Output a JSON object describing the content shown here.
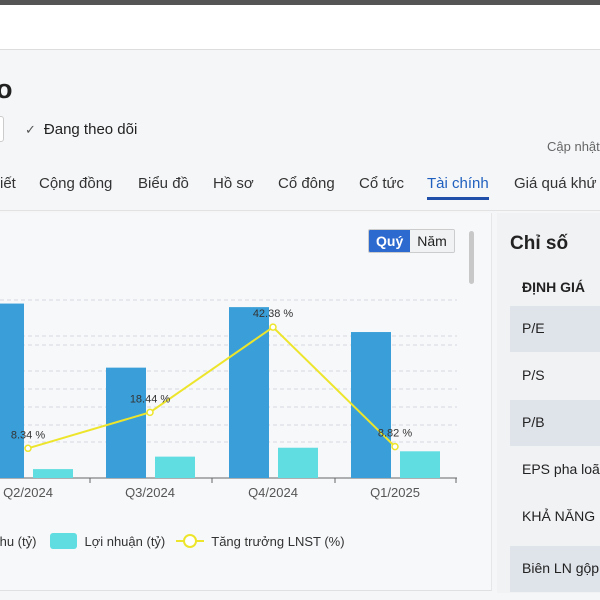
{
  "header": {
    "title": "o",
    "follow_label": "Đang theo dõi",
    "updated_label": "Cập nhật"
  },
  "tabs": [
    {
      "label": "iết"
    },
    {
      "label": "Cộng đồng"
    },
    {
      "label": "Biểu đồ"
    },
    {
      "label": "Hồ sơ"
    },
    {
      "label": "Cổ đông"
    },
    {
      "label": "Cổ tức"
    },
    {
      "label": "Tài chính",
      "active": true
    },
    {
      "label": "Giá quá khứ"
    }
  ],
  "toggle": {
    "quarter": "Quý",
    "year": "Năm"
  },
  "colors": {
    "revenue": "#3a9fd8",
    "profit": "#5fdde0",
    "growth": "#ede52c",
    "accent": "#2d6ad0"
  },
  "chart_data": {
    "type": "bar",
    "categories": [
      "Q2/2024",
      "Q3/2024",
      "Q4/2024",
      "Q1/2025"
    ],
    "series": [
      {
        "name": "Doanh thu (tỷ)",
        "legend_visible": "thu (tỷ)",
        "values": [
          98,
          62,
          96,
          82
        ]
      },
      {
        "name": "Lợi nhuận (tỷ)",
        "values": [
          5,
          12,
          17,
          15
        ]
      },
      {
        "name": "Tăng trưởng LNST (%)",
        "type": "line",
        "values": [
          8.34,
          18.44,
          42.38,
          8.82
        ],
        "labels": [
          "8.34 %",
          "18.44 %",
          "42.38 %",
          "8.82 %"
        ]
      }
    ],
    "ylim": [
      0,
      100
    ],
    "y2lim": [
      0,
      50
    ],
    "grid": true,
    "legend": "bottom"
  },
  "ratios": {
    "title": "Chỉ số",
    "rows": [
      {
        "label": "ĐỊNH GIÁ",
        "section": true
      },
      {
        "label": "P/E"
      },
      {
        "label": "P/S"
      },
      {
        "label": "P/B"
      },
      {
        "label": "EPS pha loãng"
      },
      {
        "label": "KHẢ NĂNG"
      },
      {
        "label": "Biên LN gộp"
      }
    ]
  }
}
